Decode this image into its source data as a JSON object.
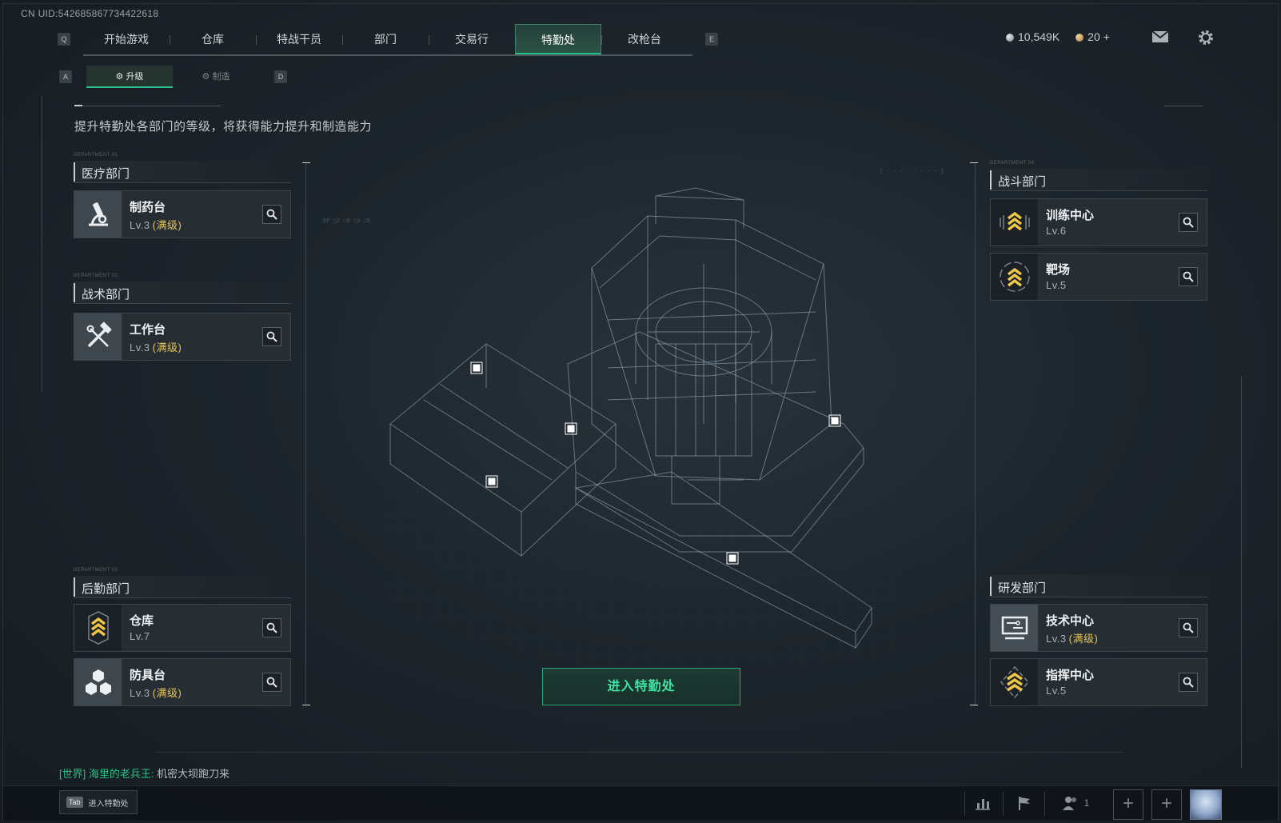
{
  "uid": "CN UID:542685867734422618",
  "keys": {
    "left_main": "Q",
    "right_main": "E",
    "left_sub": "A",
    "right_sub": "D"
  },
  "main_tabs": [
    {
      "label": "开始游戏"
    },
    {
      "label": "仓库"
    },
    {
      "label": "特战干员"
    },
    {
      "label": "部门"
    },
    {
      "label": "交易行"
    },
    {
      "label": "特勤处",
      "active": true
    },
    {
      "label": "改枪台"
    }
  ],
  "currency": {
    "silver": "10,549K",
    "gold": "20 +"
  },
  "top_icons": [
    "mail-icon",
    "gear-icon"
  ],
  "sub_tabs": [
    {
      "label": "升级",
      "active": true,
      "icon": "upgrade-icon"
    },
    {
      "label": "制造",
      "active": false,
      "icon": "craft-icon"
    }
  ],
  "subtitle": "提升特勤处各部门的等级，将获得能力提升和制造能力",
  "departments": {
    "medical": {
      "tag": "DEPARTMENT 01",
      "title": "医疗部门",
      "cards": [
        {
          "name": "制药台",
          "level": "Lv.3",
          "status": "(满级)",
          "icon": "microscope-icon"
        }
      ]
    },
    "tactical": {
      "tag": "DEPARTMENT 02",
      "title": "战术部门",
      "cards": [
        {
          "name": "工作台",
          "level": "Lv.3",
          "status": "(满级)",
          "icon": "hammer-wrench-icon"
        }
      ]
    },
    "logistics": {
      "tag": "DEPARTMENT 03",
      "title": "后勤部门",
      "cards": [
        {
          "name": "仓库",
          "level": "Lv.7",
          "status": "",
          "icon": "rank-chevron-icon"
        },
        {
          "name": "防具台",
          "level": "Lv.3",
          "status": "(满级)",
          "icon": "boxes-icon"
        }
      ]
    },
    "combat": {
      "tag": "DEPARTMENT 04",
      "title": "战斗部门",
      "cards": [
        {
          "name": "训练中心",
          "level": "Lv.6",
          "status": "",
          "icon": "rank-chevron-icon"
        },
        {
          "name": "靶场",
          "level": "Lv.5",
          "status": "",
          "icon": "rank-chevron-icon"
        }
      ]
    },
    "research": {
      "tag": "",
      "title": "研发部门",
      "cards": [
        {
          "name": "技术中心",
          "level": "Lv.3",
          "status": "(满级)",
          "icon": "monitor-icon"
        },
        {
          "name": "指挥中心",
          "level": "Lv.5",
          "status": "",
          "icon": "rank-chevron-icon"
        }
      ]
    }
  },
  "enter_button": "进入特勤处",
  "chat": {
    "channel": "[世界]",
    "sender": "海里的老兵王:",
    "message": "机密大坝跑刀来"
  },
  "tab_hint": {
    "key": "Tab",
    "label": "进入特勤处"
  },
  "bottom_bar": {
    "friends_count": "1",
    "icons": [
      "stats-icon",
      "flag-icon",
      "friends-icon"
    ],
    "slots": [
      "+",
      "+"
    ]
  },
  "colors": {
    "accent": "#2bbf8c",
    "maxed": "#e3c25c",
    "background": "#1d252c"
  }
}
